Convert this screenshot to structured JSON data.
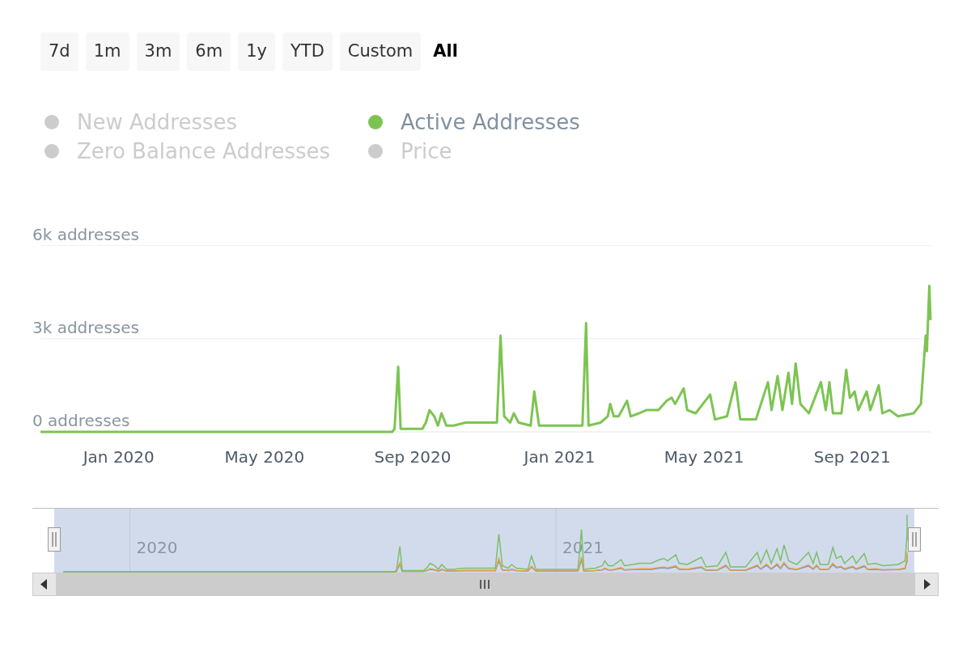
{
  "range_buttons": [
    {
      "label": "7d",
      "selected": false
    },
    {
      "label": "1m",
      "selected": false
    },
    {
      "label": "3m",
      "selected": false
    },
    {
      "label": "6m",
      "selected": false
    },
    {
      "label": "1y",
      "selected": false
    },
    {
      "label": "YTD",
      "selected": false
    },
    {
      "label": "Custom",
      "selected": false
    },
    {
      "label": "All",
      "selected": true
    }
  ],
  "legend": [
    {
      "label": "New Addresses",
      "visible": false
    },
    {
      "label": "Active Addresses",
      "visible": true,
      "color": "#7cc452"
    },
    {
      "label": "Zero Balance Addresses",
      "visible": false
    },
    {
      "label": "Price",
      "visible": false
    }
  ],
  "chart_data": {
    "type": "line",
    "xlim": [
      "2019-10-28",
      "2021-11-05"
    ],
    "ylim": [
      0,
      6000
    ],
    "yticks": [
      {
        "value": 0,
        "label": "0 addresses"
      },
      {
        "value": 3000,
        "label": "3k addresses"
      },
      {
        "value": 6000,
        "label": "6k addresses"
      }
    ],
    "xticks": [
      {
        "value": "2020-01-01",
        "label": "Jan 2020"
      },
      {
        "value": "2020-05-01",
        "label": "May 2020"
      },
      {
        "value": "2020-09-01",
        "label": "Sep 2020"
      },
      {
        "value": "2021-01-01",
        "label": "Jan 2021"
      },
      {
        "value": "2021-05-01",
        "label": "May 2021"
      },
      {
        "value": "2021-09-01",
        "label": "Sep 2021"
      }
    ],
    "x": [
      "2019-10-28",
      "2020-08-15",
      "2020-08-17",
      "2020-08-20",
      "2020-08-22",
      "2020-09-09",
      "2020-09-12",
      "2020-09-15",
      "2020-09-19",
      "2020-09-22",
      "2020-09-25",
      "2020-09-29",
      "2020-10-05",
      "2020-10-15",
      "2020-10-25",
      "2020-11-05",
      "2020-11-10",
      "2020-11-13",
      "2020-11-16",
      "2020-11-21",
      "2020-11-24",
      "2020-11-28",
      "2020-12-08",
      "2020-12-11",
      "2020-12-15",
      "2021-01-01",
      "2021-01-14",
      "2021-01-20",
      "2021-01-23",
      "2021-01-25",
      "2021-02-04",
      "2021-02-10",
      "2021-02-12",
      "2021-02-15",
      "2021-02-19",
      "2021-02-26",
      "2021-03-01",
      "2021-03-08",
      "2021-03-14",
      "2021-03-24",
      "2021-03-31",
      "2021-04-04",
      "2021-04-07",
      "2021-04-14",
      "2021-04-17",
      "2021-04-24",
      "2021-04-30",
      "2021-05-06",
      "2021-05-10",
      "2021-05-20",
      "2021-05-27",
      "2021-05-31",
      "2021-06-13",
      "2021-06-23",
      "2021-06-26",
      "2021-07-01",
      "2021-07-05",
      "2021-07-10",
      "2021-07-13",
      "2021-07-16",
      "2021-07-20",
      "2021-07-27",
      "2021-08-06",
      "2021-08-10",
      "2021-08-13",
      "2021-08-16",
      "2021-08-23",
      "2021-08-27",
      "2021-08-30",
      "2021-09-03",
      "2021-09-06",
      "2021-09-13",
      "2021-09-16",
      "2021-09-23",
      "2021-09-26",
      "2021-10-02",
      "2021-10-09",
      "2021-10-22",
      "2021-10-28",
      "2021-11-01",
      "2021-11-02",
      "2021-11-04",
      "2021-11-05"
    ],
    "series": [
      {
        "color": "#7cc452",
        "values": [
          0,
          0,
          100,
          2100,
          100,
          100,
          300,
          700,
          500,
          200,
          600,
          200,
          200,
          300,
          300,
          300,
          300,
          3100,
          500,
          300,
          600,
          300,
          200,
          1300,
          200,
          200,
          200,
          200,
          3500,
          200,
          300,
          500,
          900,
          500,
          500,
          1000,
          500,
          600,
          700,
          700,
          1000,
          1100,
          900,
          1400,
          700,
          600,
          900,
          1200,
          400,
          500,
          1600,
          400,
          400,
          1600,
          700,
          1800,
          700,
          1900,
          900,
          2200,
          900,
          600,
          1600,
          700,
          1600,
          600,
          600,
          2000,
          1100,
          1300,
          700,
          1300,
          700,
          1500,
          600,
          700,
          500,
          600,
          900,
          3100,
          2600,
          4700,
          3600
        ]
      }
    ]
  },
  "navigator": {
    "labels": [
      "2020",
      "2021"
    ]
  }
}
